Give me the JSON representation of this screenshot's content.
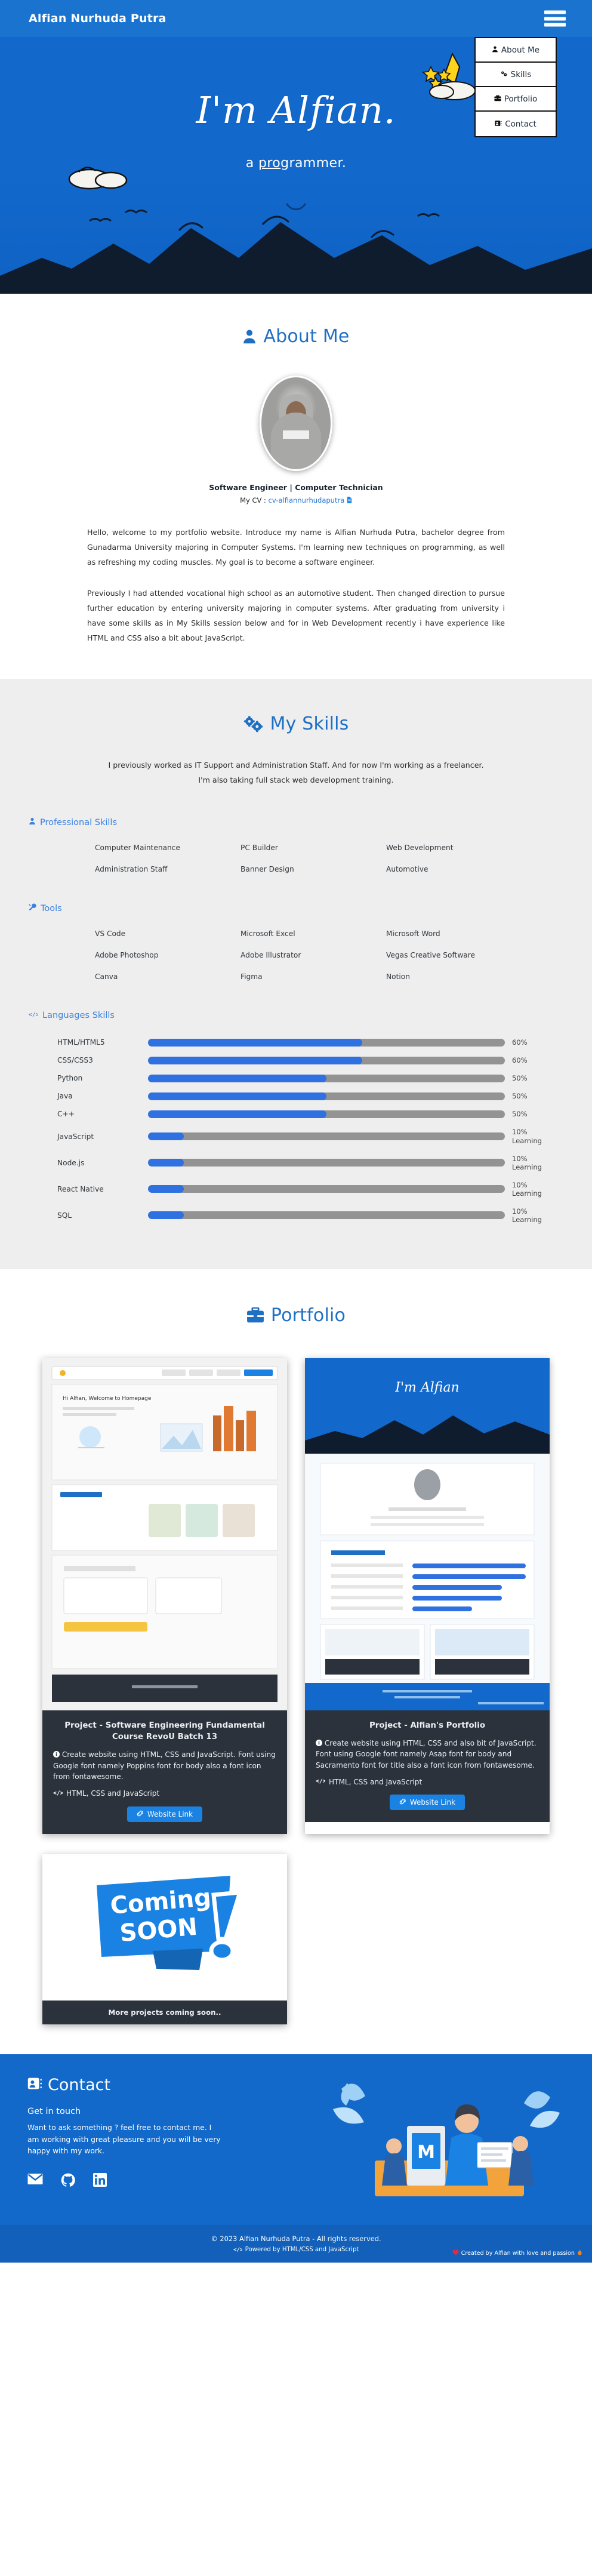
{
  "header": {
    "brand": "Alfian Nurhuda Putra",
    "menu": [
      {
        "label": "About Me",
        "icon": "user-icon"
      },
      {
        "label": "Skills",
        "icon": "cogs-icon"
      },
      {
        "label": "Portfolio",
        "icon": "briefcase-icon"
      },
      {
        "label": "Contact",
        "icon": "address-card-icon"
      }
    ]
  },
  "hero": {
    "title": "I'm Alfian.",
    "subtitle_pre": "a ",
    "subtitle_underline": "pro",
    "subtitle_post": "grammer."
  },
  "about": {
    "heading": "About Me",
    "role": "Software Engineer | Computer Technician",
    "cv_label": "My CV : ",
    "cv_link": "cv-alfiannurhudaputra",
    "paragraphs": [
      "Hello, welcome to my portfolio website. Introduce my name is Alfian Nurhuda Putra, bachelor degree from Gunadarma University majoring in Computer Systems. I'm learning new techniques on programming, as well as refreshing my coding muscles. My goal is to become a software engineer.",
      "Previously I had attended vocational high school as an automotive student. Then changed direction to pursue further education by entering university majoring in computer systems. After graduating from university i have some skills as in My Skills session below and for in Web Development recently i have experience like HTML and CSS also a bit about JavaScript."
    ]
  },
  "skills": {
    "heading": "My Skills",
    "intro_line1": "I previously worked as IT Support and Administration Staff. And for now I'm working as a freelancer.",
    "intro_line2": "I'm also taking full stack web development training.",
    "professional_heading": "Professional Skills",
    "professional": [
      "Computer Maintenance",
      "PC Builder",
      "Web Development",
      "Administration Staff",
      "Banner Design",
      "Automotive"
    ],
    "tools_heading": "Tools",
    "tools": [
      "VS Code",
      "Microsoft Excel",
      "Microsoft Word",
      "Adobe Photoshop",
      "Adobe Illustrator",
      "Vegas Creative Software",
      "Canva",
      "Figma",
      "Notion"
    ],
    "languages_heading": "Languages Skills"
  },
  "chart_data": {
    "type": "bar",
    "title": "Languages Skills",
    "orientation": "horizontal",
    "xlabel": "",
    "ylabel": "",
    "xlim": [
      0,
      100
    ],
    "categories": [
      "HTML/HTML5",
      "CSS/CSS3",
      "Python",
      "Java",
      "C++",
      "JavaScript",
      "Node.js",
      "React Native",
      "SQL"
    ],
    "values": [
      60,
      60,
      50,
      50,
      50,
      10,
      10,
      10,
      10
    ],
    "value_labels": [
      "60%",
      "60%",
      "50%",
      "50%",
      "50%",
      "10%\nLearning",
      "10%\nLearning",
      "10%\nLearning",
      "10%\nLearning"
    ],
    "notes": [
      "",
      "",
      "",
      "",
      "",
      "Learning",
      "Learning",
      "Learning",
      "Learning"
    ],
    "fill_color": "#2f71e0",
    "track_color": "#939393"
  },
  "portfolio": {
    "heading": "Portfolio",
    "projects": [
      {
        "title": "Project - Software Engineering Fundamental Course RevoU Batch 13",
        "description": "Create website using HTML, CSS and JavaScript. Font using Google font namely Poppins font for body also a font icon from fontawesome.",
        "tech": "HTML, CSS and JavaScript",
        "button": "Website Link"
      },
      {
        "title": "Project - Alfian's Portfolio",
        "description": "Create website using HTML, CSS and also bit of JavaScript. Font using Google font namely Asap font for body and Sacramento font for title also a font icon from fontawesome.",
        "tech": "HTML, CSS and JavaScript",
        "button": "Website Link"
      },
      {
        "title": "More projects coming soon..",
        "image_text_line1": "Coming",
        "image_text_line2": "SOON"
      }
    ]
  },
  "contact": {
    "heading": "Contact",
    "subheading": "Get in touch",
    "text": "Want to ask something ? feel free to contact me. I am working with great pleasure and you will be very happy with my work.",
    "socials": [
      "email-icon",
      "github-icon",
      "linkedin-icon"
    ]
  },
  "footer": {
    "copyright": "© 2023 Alfian Nurhuda Putra - All rights reserved.",
    "powered": "Powered by HTML/CSS and JavaScript",
    "credit": "Created by Alfian with love and passion"
  }
}
